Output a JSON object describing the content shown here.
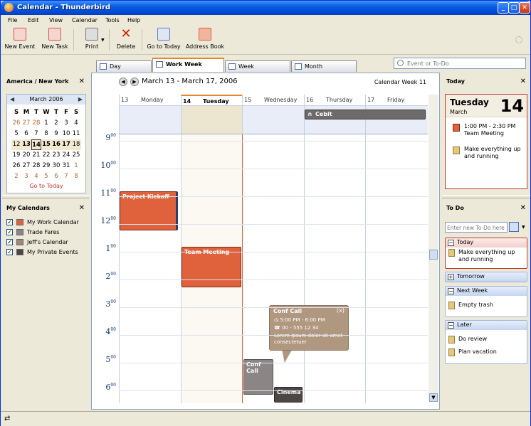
{
  "window": {
    "title": "Calendar - Thunderbird"
  },
  "menu": [
    "File",
    "Edit",
    "View",
    "Calendar",
    "Tools",
    "Help"
  ],
  "toolbar": [
    {
      "label": "New Event",
      "icon": "new-event-icon",
      "color": "#d9534f"
    },
    {
      "label": "New Task",
      "icon": "new-task-icon",
      "color": "#d9534f"
    },
    {
      "label": "Print",
      "icon": "print-icon",
      "color": "#777"
    },
    {
      "label": "Delete",
      "icon": "delete-icon",
      "color": "#cc2200"
    },
    {
      "label": "Go to Today",
      "icon": "go-to-today-icon",
      "color": "#5a7fbf"
    },
    {
      "label": "Address Book",
      "icon": "address-book-icon",
      "color": "#e06040"
    }
  ],
  "tabs": [
    "Day",
    "Work Week",
    "Week",
    "Month"
  ],
  "active_tab": "Work Week",
  "search": {
    "placeholder": "Event or To-Do"
  },
  "left": {
    "timezone": "America / New York",
    "minical": {
      "month": "March 2006",
      "dow": [
        "S",
        "M",
        "T",
        "W",
        "T",
        "F",
        "S"
      ],
      "weeks": [
        [
          "26",
          "27",
          "28",
          "1",
          "2",
          "3",
          "4"
        ],
        [
          "5",
          "6",
          "7",
          "8",
          "9",
          "10",
          "11"
        ],
        [
          "12",
          "13",
          "14",
          "15",
          "16",
          "17",
          "18"
        ],
        [
          "19",
          "20",
          "21",
          "22",
          "23",
          "24",
          "25"
        ],
        [
          "26",
          "27",
          "28",
          "29",
          "30",
          "31",
          "1"
        ],
        [
          "2",
          "3",
          "4",
          "5",
          "6",
          "7",
          "8"
        ]
      ],
      "go_today": "Go to Today"
    },
    "my_calendars_title": "My Calendars",
    "calendars": [
      {
        "name": "My Work Calendar",
        "color": "#e0623d",
        "checked": true
      },
      {
        "name": "Trade Fares",
        "color": "#8b8585",
        "checked": true
      },
      {
        "name": "Jeff's Calendar",
        "color": "#a08878",
        "checked": true
      },
      {
        "name": "My Private Events",
        "color": "#4e4645",
        "checked": true
      }
    ]
  },
  "main": {
    "range": "March 13 - March 17, 2006",
    "week_label": "Calendar Week 11",
    "days": [
      {
        "num": "13",
        "name": "Monday"
      },
      {
        "num": "14",
        "name": "Tuesday"
      },
      {
        "num": "15",
        "name": "Wednesday"
      },
      {
        "num": "16",
        "name": "Thursday"
      },
      {
        "num": "17",
        "name": "Friday"
      }
    ],
    "hours": [
      "9",
      "10",
      "11",
      "12",
      "1",
      "2",
      "3",
      "4",
      "5",
      "6"
    ],
    "hour_sup": "00",
    "events": {
      "kickoff": "Project Kickoff",
      "meeting": "Team Meeting",
      "conf": "Conf Call",
      "cinema": "Cinema",
      "cebit": "Cebit"
    },
    "tooltip": {
      "title": "Conf Call",
      "close": "(x)",
      "time": "5:00 PM - 6:00 PM",
      "phone": "00 - 555 12 34",
      "desc": "Lorem ipsum dolor sit amet consectetuer"
    }
  },
  "right": {
    "today_title": "Today",
    "day_name": "Tuesday",
    "day_num": "14",
    "month": "March",
    "agenda": [
      {
        "text": "1:00 PM - 2:30 PM Team Meeting",
        "type": "event"
      },
      {
        "text": "Make everything up and running",
        "type": "task"
      }
    ],
    "todo_title": "To Do",
    "todo_placeholder": "Enter new To-Do here",
    "groups": {
      "today": {
        "label": "Today",
        "items": [
          "Make everything up and running"
        ]
      },
      "tomorrow": {
        "label": "Tomorrow"
      },
      "next_week": {
        "label": "Next Week",
        "items": [
          "Empty trash"
        ]
      },
      "later": {
        "label": "Later",
        "items": [
          "Do review",
          "Plan vacation"
        ]
      }
    }
  }
}
